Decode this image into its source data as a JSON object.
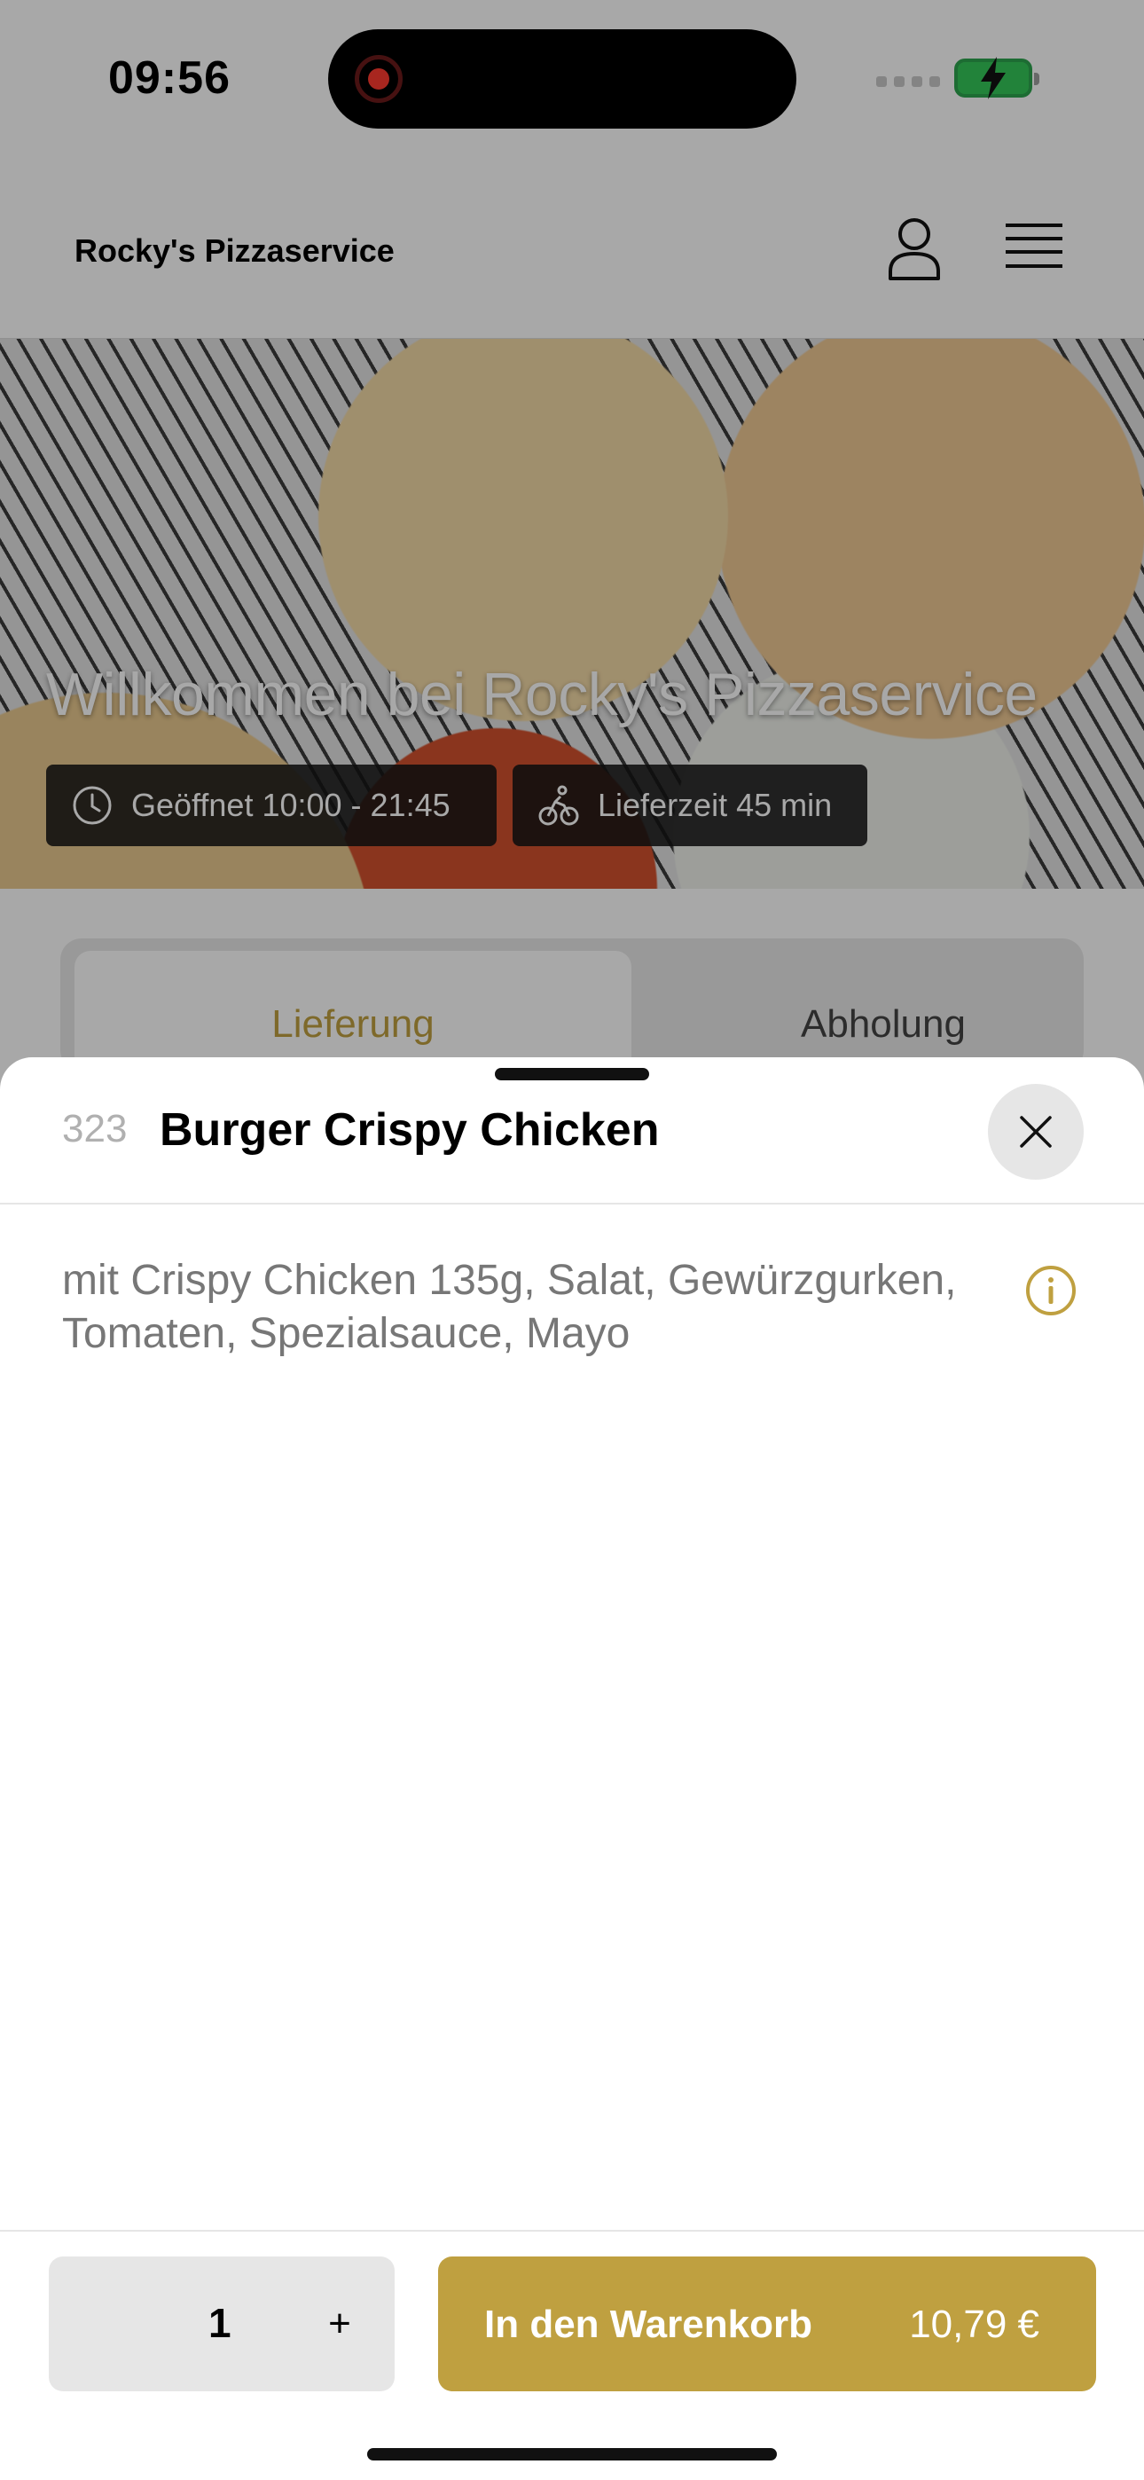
{
  "status_bar": {
    "time": "09:56"
  },
  "header": {
    "brand": "Rocky's Pizzaservice"
  },
  "hero": {
    "title": "Willkommen bei Rocky's Pizzaservice",
    "opening_hours": "Geöffnet 10:00 - 21:45",
    "delivery_time": "Lieferzeit 45 min"
  },
  "order_tabs": [
    {
      "label": "Lieferung",
      "selected": true
    },
    {
      "label": "Abholung",
      "selected": false
    }
  ],
  "product_sheet": {
    "number": "323",
    "title": "Burger Crispy Chicken",
    "description": "mit Crispy Chicken 135g, Salat, Gewürzgurken, Tomaten, Spezialsauce, Mayo"
  },
  "footer": {
    "quantity": "1",
    "plus_label": "+",
    "add_to_cart_label": "In den Warenkorb",
    "price": "10,79 €"
  },
  "colors": {
    "accent": "#bfa040",
    "overlay": "rgba(0,0,0,0.34)"
  }
}
